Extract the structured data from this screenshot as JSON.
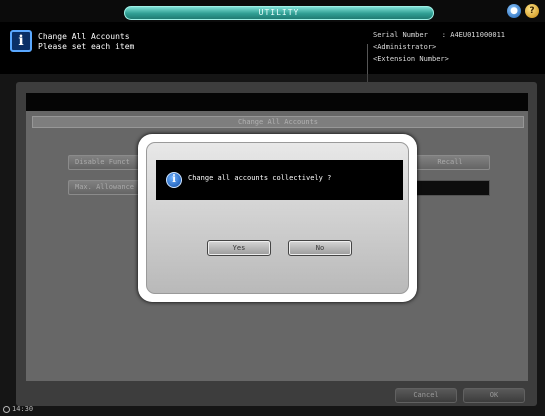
{
  "topbar": {
    "tab_label": "UTILITY",
    "icons": [
      "app-icon",
      "help-icon"
    ]
  },
  "header": {
    "title_line1": "Change All Accounts",
    "title_line2": "Please set each item",
    "serial_label": "Serial Number",
    "serial_value": ": A4EU011000011",
    "role": "<Administrator>",
    "extension": "<Extension Number>"
  },
  "panel": {
    "title": "Change All Accounts",
    "btn_disable": "Disable Funct",
    "btn_allowance": "Max. Allowance",
    "btn_recall": "Recall"
  },
  "dialog": {
    "message": "Change all accounts collectively ?",
    "yes_label": "Yes",
    "no_label": "No"
  },
  "footer": {
    "cancel_label": "Cancel",
    "ok_label": "OK",
    "clock": "14:30"
  }
}
